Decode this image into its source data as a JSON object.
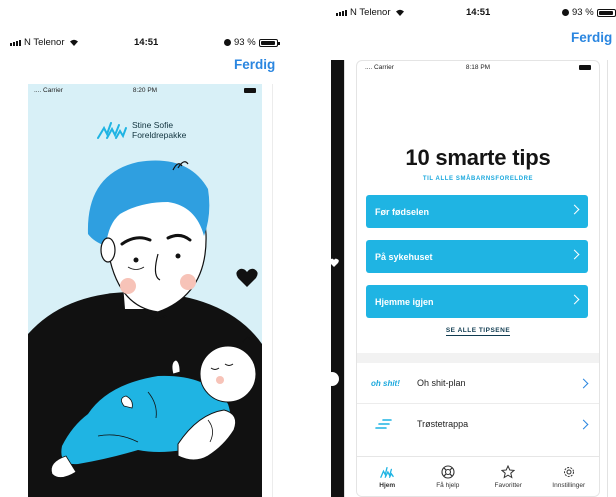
{
  "left_screen": {
    "status_bar": {
      "carrier": "N Telenor",
      "time": "14:51",
      "battery": "93 %"
    },
    "done_label": "Ferdig",
    "preview": {
      "status_bar": {
        "carrier": ".... Carrier",
        "time": "8:20 PM"
      },
      "logo_line1": "Stine Sofie",
      "logo_line2": "Foreldrepakke"
    }
  },
  "right_screen": {
    "status_bar": {
      "carrier": "N Telenor",
      "time": "14:51",
      "battery": "93 %"
    },
    "done_label": "Ferdig",
    "preview": {
      "status_bar": {
        "carrier": ".... Carrier",
        "time": "8:18 PM"
      },
      "title": "10 smarte tips",
      "subtitle": "TIL ALLE SMÅBARNSFORELDRE",
      "tip_buttons": [
        "Før fødselen",
        "På sykehuset",
        "Hjemme igjen"
      ],
      "see_all": "SE ALLE TIPSENE",
      "list_rows": [
        {
          "badge": "oh shit!",
          "label": "Oh shit-plan",
          "icon": ""
        },
        {
          "badge": "",
          "label": "Trøstetrappa",
          "icon": "stairs-icon"
        }
      ],
      "tabs": [
        {
          "label": "Hjem",
          "icon": "home-logo-icon"
        },
        {
          "label": "Få hjelp",
          "icon": "lifebuoy-icon"
        },
        {
          "label": "Favoritter",
          "icon": "star-icon"
        },
        {
          "label": "Innstillinger",
          "icon": "gear-icon"
        }
      ]
    }
  },
  "colors": {
    "accent": "#1fb4e3",
    "link_blue": "#2a86e0",
    "illustration_bg": "#d8f0f7",
    "dad_hair": "#2f9fe0"
  }
}
